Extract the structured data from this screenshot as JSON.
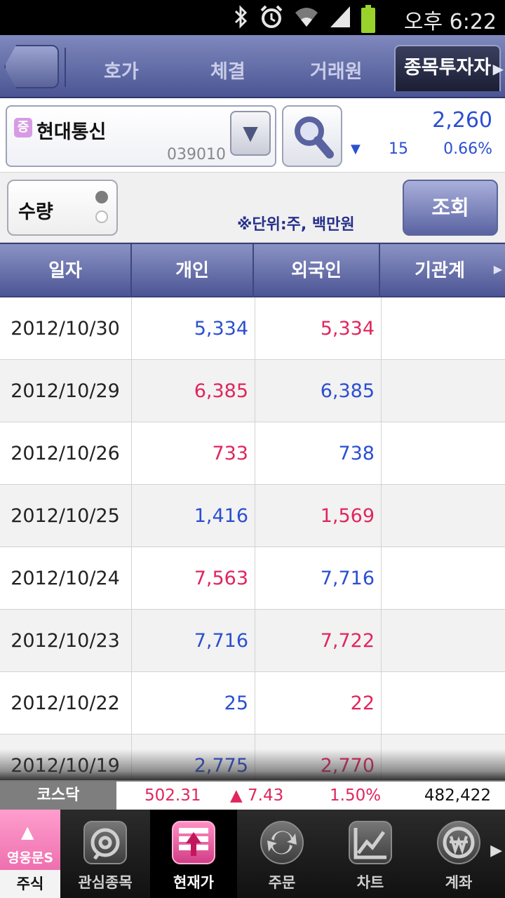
{
  "status_bar": {
    "time": "오후 6:22",
    "icons": [
      "bluetooth-icon",
      "alarm-icon",
      "wifi-icon",
      "signal-icon",
      "battery-icon"
    ]
  },
  "tabs": [
    {
      "label": "호가"
    },
    {
      "label": "체결"
    },
    {
      "label": "거래원"
    },
    {
      "label": "종목투자자",
      "active": true
    }
  ],
  "stock": {
    "badge": "증",
    "name": "현대통신",
    "code": "039010",
    "price": "2,260",
    "change_arrow": "▼",
    "change": "15",
    "change_pct": "0.66%"
  },
  "options": {
    "mode_label": "수량",
    "unit_note": "※단위:주, 백만원",
    "query_label": "조회"
  },
  "table": {
    "headers": [
      "일자",
      "개인",
      "외국인",
      "기관계"
    ],
    "rows": [
      {
        "date": "2012/10/30",
        "individual": "5,334",
        "foreign": "5,334",
        "ind_dir": "down",
        "for_dir": "up"
      },
      {
        "date": "2012/10/29",
        "individual": "6,385",
        "foreign": "6,385",
        "ind_dir": "up",
        "for_dir": "down"
      },
      {
        "date": "2012/10/26",
        "individual": "733",
        "foreign": "738",
        "ind_dir": "up",
        "for_dir": "down"
      },
      {
        "date": "2012/10/25",
        "individual": "1,416",
        "foreign": "1,569",
        "ind_dir": "down",
        "for_dir": "up"
      },
      {
        "date": "2012/10/24",
        "individual": "7,563",
        "foreign": "7,716",
        "ind_dir": "up",
        "for_dir": "down"
      },
      {
        "date": "2012/10/23",
        "individual": "7,716",
        "foreign": "7,722",
        "ind_dir": "down",
        "for_dir": "up"
      },
      {
        "date": "2012/10/22",
        "individual": "25",
        "foreign": "22",
        "ind_dir": "down",
        "for_dir": "up"
      },
      {
        "date": "2012/10/19",
        "individual": "2,775",
        "foreign": "2,770",
        "ind_dir": "down",
        "for_dir": "up"
      }
    ]
  },
  "ticker": {
    "name": "코스닥",
    "value": "502.31",
    "change": "▲ 7.43",
    "change_pct": "1.50%",
    "volume": "482,422"
  },
  "bottom_nav": {
    "first": {
      "sub": "영웅문S",
      "label": "주식"
    },
    "items": [
      {
        "label": "관심종목",
        "icon": "watchlist-icon"
      },
      {
        "label": "현재가",
        "icon": "current-price-icon",
        "active": true
      },
      {
        "label": "주문",
        "icon": "order-icon"
      },
      {
        "label": "차트",
        "icon": "chart-icon"
      },
      {
        "label": "계좌",
        "icon": "account-icon"
      }
    ]
  },
  "colors": {
    "up": "#e0265d",
    "down": "#2c4fd0",
    "header": "#4c5594"
  }
}
